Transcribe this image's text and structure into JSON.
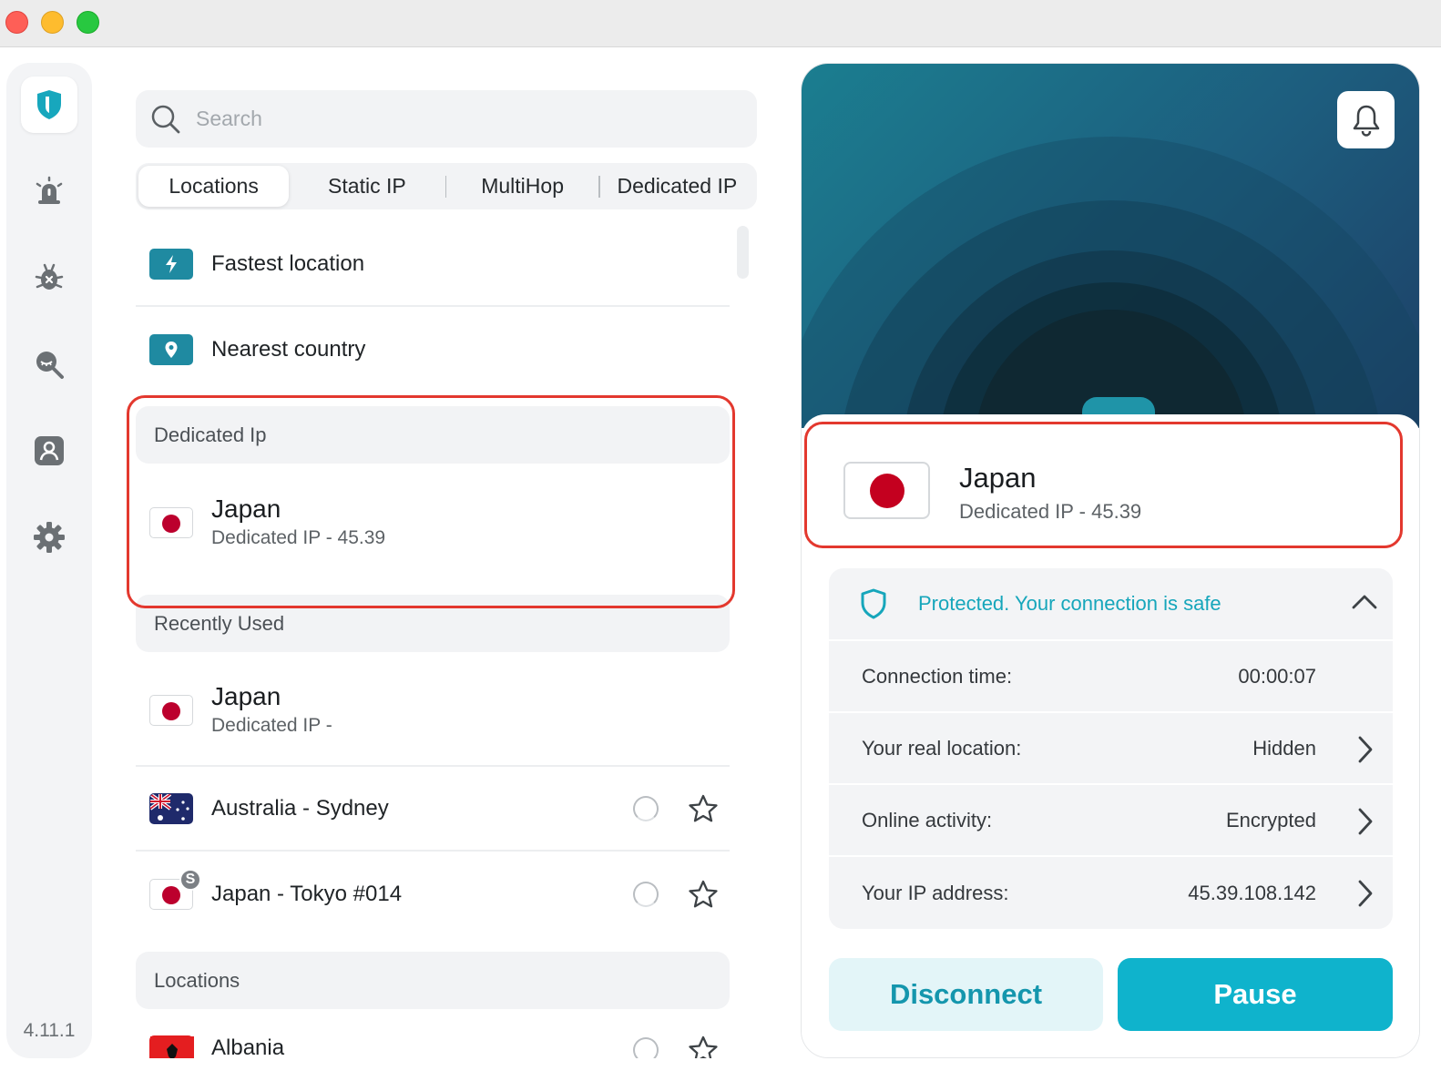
{
  "sidebar": {
    "items": [
      {
        "icon": "shield-logo-icon",
        "active": true
      },
      {
        "icon": "alarm-icon"
      },
      {
        "icon": "bug-blocker-icon"
      },
      {
        "icon": "search-privacy-icon"
      },
      {
        "icon": "account-icon"
      },
      {
        "icon": "settings-gear-icon"
      }
    ],
    "version": "4.11.1"
  },
  "search": {
    "placeholder": "Search"
  },
  "tabs": [
    "Locations",
    "Static IP",
    "MultiHop",
    "Dedicated IP"
  ],
  "quick": {
    "fastest": "Fastest location",
    "nearest": "Nearest country"
  },
  "dedicated": {
    "header": "Dedicated Ip",
    "item": {
      "name": "Japan",
      "detail": "Dedicated IP - 45.39"
    }
  },
  "recent": {
    "header": "Recently Used",
    "items": [
      {
        "name": "Japan",
        "detail": "Dedicated IP -"
      },
      {
        "name": "Australia - Sydney"
      },
      {
        "name": "Japan - Tokyo #014",
        "badge": "S"
      }
    ]
  },
  "locations": {
    "header": "Locations",
    "first": "Albania"
  },
  "connection": {
    "country": "Japan",
    "detail": "Dedicated IP - 45.39",
    "status": "Protected. Your connection is safe",
    "rows": [
      {
        "label": "Connection time:",
        "value": "00:00:07"
      },
      {
        "label": "Your real location:",
        "value": "Hidden"
      },
      {
        "label": "Online activity:",
        "value": "Encrypted"
      },
      {
        "label": "Your IP address:",
        "value": "45.39.108.142"
      }
    ]
  },
  "buttons": {
    "disconnect": "Disconnect",
    "pause": "Pause"
  },
  "colors": {
    "accent": "#0fb3cc",
    "highlight": "#e3382e",
    "japan_red": "#bc002d"
  }
}
